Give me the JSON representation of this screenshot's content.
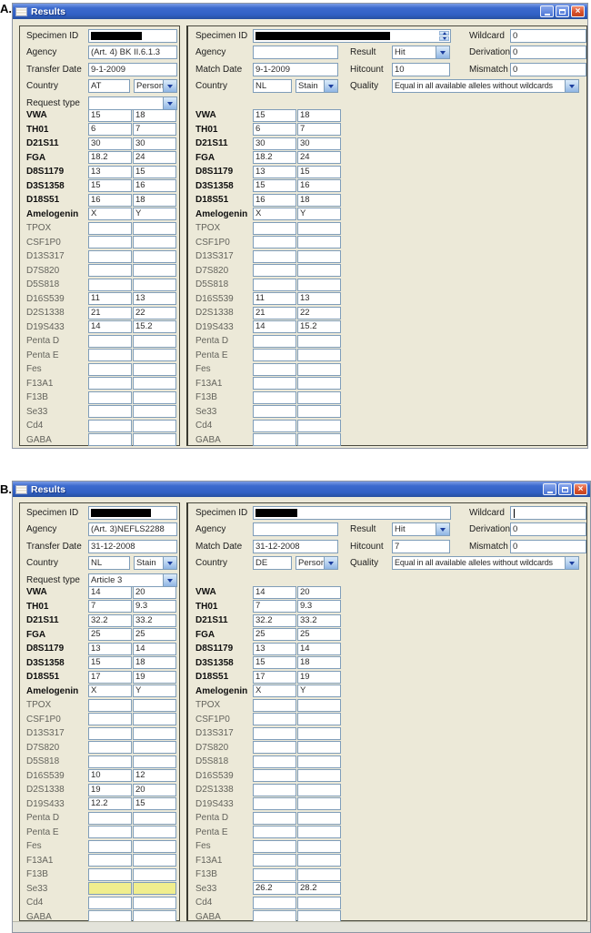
{
  "ui": {
    "close_glyph": "×"
  },
  "figures": [
    {
      "label": "A.",
      "title": "Results",
      "left": {
        "fields": {
          "specimen_label": "Specimen ID",
          "agency_label": "Agency",
          "agency_value": "(Art. 4) BK II.6.1.3",
          "date_label": "Transfer Date",
          "date_value": "9-1-2009",
          "country_label": "Country",
          "country_code": "AT",
          "country_kind": "Person",
          "request_label": "Request type",
          "request_value": ""
        },
        "markers": [
          {
            "name": "VWA",
            "a": "15",
            "b": "18",
            "bold": true
          },
          {
            "name": "TH01",
            "a": "6",
            "b": "7",
            "bold": true
          },
          {
            "name": "D21S11",
            "a": "30",
            "b": "30",
            "bold": true
          },
          {
            "name": "FGA",
            "a": "18.2",
            "b": "24",
            "bold": true
          },
          {
            "name": "D8S1179",
            "a": "13",
            "b": "15",
            "bold": true
          },
          {
            "name": "D3S1358",
            "a": "15",
            "b": "16",
            "bold": true
          },
          {
            "name": "D18S51",
            "a": "16",
            "b": "18",
            "bold": true
          },
          {
            "name": "Amelogenin",
            "a": "X",
            "b": "Y",
            "bold": true
          },
          {
            "name": "TPOX",
            "a": "",
            "b": "",
            "bold": false
          },
          {
            "name": "CSF1P0",
            "a": "",
            "b": "",
            "bold": false
          },
          {
            "name": "D13S317",
            "a": "",
            "b": "",
            "bold": false
          },
          {
            "name": "D7S820",
            "a": "",
            "b": "",
            "bold": false
          },
          {
            "name": "D5S818",
            "a": "",
            "b": "",
            "bold": false
          },
          {
            "name": "D16S539",
            "a": "11",
            "b": "13",
            "bold": false
          },
          {
            "name": "D2S1338",
            "a": "21",
            "b": "22",
            "bold": false
          },
          {
            "name": "D19S433",
            "a": "14",
            "b": "15.2",
            "bold": false
          },
          {
            "name": "Penta D",
            "a": "",
            "b": "",
            "bold": false
          },
          {
            "name": "Penta E",
            "a": "",
            "b": "",
            "bold": false
          },
          {
            "name": "Fes",
            "a": "",
            "b": "",
            "bold": false
          },
          {
            "name": "F13A1",
            "a": "",
            "b": "",
            "bold": false
          },
          {
            "name": "F13B",
            "a": "",
            "b": "",
            "bold": false
          },
          {
            "name": "Se33",
            "a": "",
            "b": "",
            "bold": false
          },
          {
            "name": "Cd4",
            "a": "",
            "b": "",
            "bold": false
          },
          {
            "name": "GABA",
            "a": "",
            "b": "",
            "bold": false
          }
        ]
      },
      "right": {
        "fields": {
          "specimen_label": "Specimen ID",
          "agency_label": "Agency",
          "agency_value": "",
          "date_label": "Match Date",
          "date_value": "9-1-2009",
          "country_label": "Country",
          "country_code": "NL",
          "country_kind": "Stain",
          "result_label": "Result",
          "result_value": "Hit",
          "hitcount_label": "Hitcount",
          "hitcount_value": "10",
          "quality_label": "Quality",
          "quality_value": "Equal in all available alleles without wildcards",
          "wildcard_label": "Wildcard",
          "wildcard_value": "0",
          "derivation_label": "Derivation",
          "derivation_value": "0",
          "mismatch_label": "Mismatch",
          "mismatch_value": "0"
        },
        "markers": [
          {
            "name": "VWA",
            "a": "15",
            "b": "18",
            "bold": true
          },
          {
            "name": "TH01",
            "a": "6",
            "b": "7",
            "bold": true
          },
          {
            "name": "D21S11",
            "a": "30",
            "b": "30",
            "bold": true
          },
          {
            "name": "FGA",
            "a": "18.2",
            "b": "24",
            "bold": true
          },
          {
            "name": "D8S1179",
            "a": "13",
            "b": "15",
            "bold": true
          },
          {
            "name": "D3S1358",
            "a": "15",
            "b": "16",
            "bold": true
          },
          {
            "name": "D18S51",
            "a": "16",
            "b": "18",
            "bold": true
          },
          {
            "name": "Amelogenin",
            "a": "X",
            "b": "Y",
            "bold": true
          },
          {
            "name": "TPOX",
            "a": "",
            "b": "",
            "bold": false
          },
          {
            "name": "CSF1P0",
            "a": "",
            "b": "",
            "bold": false
          },
          {
            "name": "D13S317",
            "a": "",
            "b": "",
            "bold": false
          },
          {
            "name": "D7S820",
            "a": "",
            "b": "",
            "bold": false
          },
          {
            "name": "D5S818",
            "a": "",
            "b": "",
            "bold": false
          },
          {
            "name": "D16S539",
            "a": "11",
            "b": "13",
            "bold": false
          },
          {
            "name": "D2S1338",
            "a": "21",
            "b": "22",
            "bold": false
          },
          {
            "name": "D19S433",
            "a": "14",
            "b": "15.2",
            "bold": false
          },
          {
            "name": "Penta D",
            "a": "",
            "b": "",
            "bold": false
          },
          {
            "name": "Penta E",
            "a": "",
            "b": "",
            "bold": false
          },
          {
            "name": "Fes",
            "a": "",
            "b": "",
            "bold": false
          },
          {
            "name": "F13A1",
            "a": "",
            "b": "",
            "bold": false
          },
          {
            "name": "F13B",
            "a": "",
            "b": "",
            "bold": false
          },
          {
            "name": "Se33",
            "a": "",
            "b": "",
            "bold": false
          },
          {
            "name": "Cd4",
            "a": "",
            "b": "",
            "bold": false
          },
          {
            "name": "GABA",
            "a": "",
            "b": "",
            "bold": false
          }
        ]
      }
    },
    {
      "label": "B.",
      "title": "Results",
      "left": {
        "fields": {
          "specimen_label": "Specimen ID",
          "agency_label": "Agency",
          "agency_value": "(Art. 3)NEFLS2288",
          "date_label": "Transfer Date",
          "date_value": "31-12-2008",
          "country_label": "Country",
          "country_code": "NL",
          "country_kind": "Stain",
          "request_label": "Request type",
          "request_value": "Article 3"
        },
        "markers": [
          {
            "name": "VWA",
            "a": "14",
            "b": "20",
            "bold": true
          },
          {
            "name": "TH01",
            "a": "7",
            "b": "9.3",
            "bold": true
          },
          {
            "name": "D21S11",
            "a": "32.2",
            "b": "33.2",
            "bold": true
          },
          {
            "name": "FGA",
            "a": "25",
            "b": "25",
            "bold": true
          },
          {
            "name": "D8S1179",
            "a": "13",
            "b": "14",
            "bold": true
          },
          {
            "name": "D3S1358",
            "a": "15",
            "b": "18",
            "bold": true
          },
          {
            "name": "D18S51",
            "a": "17",
            "b": "19",
            "bold": true
          },
          {
            "name": "Amelogenin",
            "a": "X",
            "b": "Y",
            "bold": true
          },
          {
            "name": "TPOX",
            "a": "",
            "b": "",
            "bold": false
          },
          {
            "name": "CSF1P0",
            "a": "",
            "b": "",
            "bold": false
          },
          {
            "name": "D13S317",
            "a": "",
            "b": "",
            "bold": false
          },
          {
            "name": "D7S820",
            "a": "",
            "b": "",
            "bold": false
          },
          {
            "name": "D5S818",
            "a": "",
            "b": "",
            "bold": false
          },
          {
            "name": "D16S539",
            "a": "10",
            "b": "12",
            "bold": false
          },
          {
            "name": "D2S1338",
            "a": "19",
            "b": "20",
            "bold": false
          },
          {
            "name": "D19S433",
            "a": "12.2",
            "b": "15",
            "bold": false
          },
          {
            "name": "Penta D",
            "a": "",
            "b": "",
            "bold": false
          },
          {
            "name": "Penta E",
            "a": "",
            "b": "",
            "bold": false
          },
          {
            "name": "Fes",
            "a": "",
            "b": "",
            "bold": false
          },
          {
            "name": "F13A1",
            "a": "",
            "b": "",
            "bold": false
          },
          {
            "name": "F13B",
            "a": "",
            "b": "",
            "bold": false
          },
          {
            "name": "Se33",
            "a": "",
            "b": "",
            "bold": false,
            "highlight": true
          },
          {
            "name": "Cd4",
            "a": "",
            "b": "",
            "bold": false
          },
          {
            "name": "GABA",
            "a": "",
            "b": "",
            "bold": false
          }
        ]
      },
      "right": {
        "fields": {
          "specimen_label": "Specimen ID",
          "agency_label": "Agency",
          "agency_value": "",
          "date_label": "Match Date",
          "date_value": "31-12-2008",
          "country_label": "Country",
          "country_code": "DE",
          "country_kind": "Person",
          "result_label": "Result",
          "result_value": "Hit",
          "hitcount_label": "Hitcount",
          "hitcount_value": "7",
          "quality_label": "Quality",
          "quality_value": "Equal in all available alleles without wildcards",
          "wildcard_label": "Wildcard",
          "wildcard_value": "",
          "derivation_label": "Derivation",
          "derivation_value": "0",
          "mismatch_label": "Mismatch",
          "mismatch_value": "0"
        },
        "markers": [
          {
            "name": "VWA",
            "a": "14",
            "b": "20",
            "bold": true
          },
          {
            "name": "TH01",
            "a": "7",
            "b": "9.3",
            "bold": true
          },
          {
            "name": "D21S11",
            "a": "32.2",
            "b": "33.2",
            "bold": true
          },
          {
            "name": "FGA",
            "a": "25",
            "b": "25",
            "bold": true
          },
          {
            "name": "D8S1179",
            "a": "13",
            "b": "14",
            "bold": true
          },
          {
            "name": "D3S1358",
            "a": "15",
            "b": "18",
            "bold": true
          },
          {
            "name": "D18S51",
            "a": "17",
            "b": "19",
            "bold": true
          },
          {
            "name": "Amelogenin",
            "a": "X",
            "b": "Y",
            "bold": true
          },
          {
            "name": "TPOX",
            "a": "",
            "b": "",
            "bold": false
          },
          {
            "name": "CSF1P0",
            "a": "",
            "b": "",
            "bold": false
          },
          {
            "name": "D13S317",
            "a": "",
            "b": "",
            "bold": false
          },
          {
            "name": "D7S820",
            "a": "",
            "b": "",
            "bold": false
          },
          {
            "name": "D5S818",
            "a": "",
            "b": "",
            "bold": false
          },
          {
            "name": "D16S539",
            "a": "",
            "b": "",
            "bold": false
          },
          {
            "name": "D2S1338",
            "a": "",
            "b": "",
            "bold": false
          },
          {
            "name": "D19S433",
            "a": "",
            "b": "",
            "bold": false
          },
          {
            "name": "Penta D",
            "a": "",
            "b": "",
            "bold": false
          },
          {
            "name": "Penta E",
            "a": "",
            "b": "",
            "bold": false
          },
          {
            "name": "Fes",
            "a": "",
            "b": "",
            "bold": false
          },
          {
            "name": "F13A1",
            "a": "",
            "b": "",
            "bold": false
          },
          {
            "name": "F13B",
            "a": "",
            "b": "",
            "bold": false
          },
          {
            "name": "Se33",
            "a": "26.2",
            "b": "28.2",
            "bold": false
          },
          {
            "name": "Cd4",
            "a": "",
            "b": "",
            "bold": false
          },
          {
            "name": "GABA",
            "a": "",
            "b": "",
            "bold": false
          }
        ]
      }
    }
  ]
}
